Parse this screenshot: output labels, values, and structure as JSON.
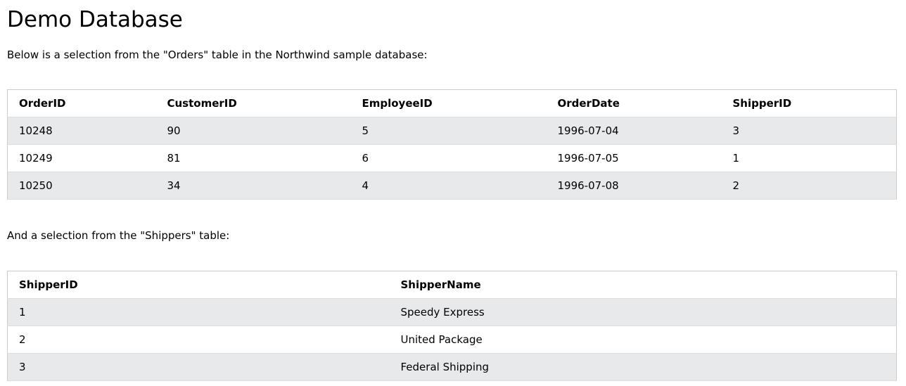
{
  "page": {
    "title": "Demo Database",
    "intro": "Below is a selection from the \"Orders\" table in the Northwind sample database:",
    "intro2": "And a selection from the \"Shippers\" table:"
  },
  "orders": {
    "headers": [
      "OrderID",
      "CustomerID",
      "EmployeeID",
      "OrderDate",
      "ShipperID"
    ],
    "rows": [
      [
        "10248",
        "90",
        "5",
        "1996-07-04",
        "3"
      ],
      [
        "10249",
        "81",
        "6",
        "1996-07-05",
        "1"
      ],
      [
        "10250",
        "34",
        "4",
        "1996-07-08",
        "2"
      ]
    ]
  },
  "shippers": {
    "headers": [
      "ShipperID",
      "ShipperName"
    ],
    "rows": [
      [
        "1",
        "Speedy Express"
      ],
      [
        "2",
        "United Package"
      ],
      [
        "3",
        "Federal Shipping"
      ]
    ]
  },
  "colors": {
    "stripe": "#e7e9eb",
    "border": "#cccccc"
  }
}
